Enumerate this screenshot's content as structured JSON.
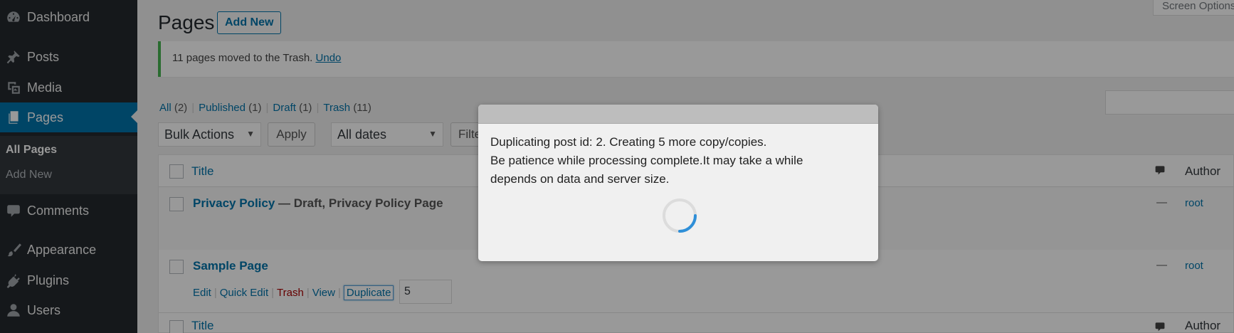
{
  "sidebar": {
    "items": [
      {
        "label": "Dashboard",
        "icon": "dashboard-icon"
      },
      {
        "label": "Posts",
        "icon": "pushpin-icon"
      },
      {
        "label": "Media",
        "icon": "media-icon"
      },
      {
        "label": "Pages",
        "icon": "pages-icon"
      },
      {
        "label": "Comments",
        "icon": "comment-icon"
      },
      {
        "label": "Appearance",
        "icon": "paintbrush-icon"
      },
      {
        "label": "Plugins",
        "icon": "plug-icon"
      },
      {
        "label": "Users",
        "icon": "user-icon"
      }
    ],
    "submenu": [
      "All Pages",
      "Add New"
    ]
  },
  "header": {
    "title": "Pages",
    "add_new": "Add New",
    "screen_options": "Screen Options"
  },
  "notice": {
    "text": "11 pages moved to the Trash.",
    "undo": "Undo"
  },
  "views": {
    "all": "All",
    "all_count": "(2)",
    "published": "Published",
    "published_count": "(1)",
    "draft": "Draft",
    "draft_count": "(1)",
    "trash": "Trash",
    "trash_count": "(11)"
  },
  "filters": {
    "bulk_actions": "Bulk Actions",
    "apply": "Apply",
    "all_dates": "All dates",
    "filter": "Filter"
  },
  "table": {
    "col_title": "Title",
    "col_author": "Author",
    "rows": [
      {
        "title": "Privacy Policy",
        "state": " — Draft, Privacy Policy Page",
        "author": "root",
        "comments": "—"
      },
      {
        "title": "Sample Page",
        "state": "",
        "author": "root",
        "comments": "—"
      }
    ],
    "row_actions": {
      "edit": "Edit",
      "quick_edit": "Quick Edit",
      "trash": "Trash",
      "view": "View",
      "duplicate": "Duplicate",
      "dup_count": "5"
    }
  },
  "modal": {
    "line1": "Duplicating post id: 2. Creating 5 more copy/copies.",
    "line2": "Be patience while processing complete.It may take a while",
    "line3": "depends on data and server size."
  },
  "colors": {
    "accent": "#0073aa",
    "sidebar_bg": "#23282d",
    "notice_success": "#46b450",
    "spinner": "#2f8fd8"
  }
}
